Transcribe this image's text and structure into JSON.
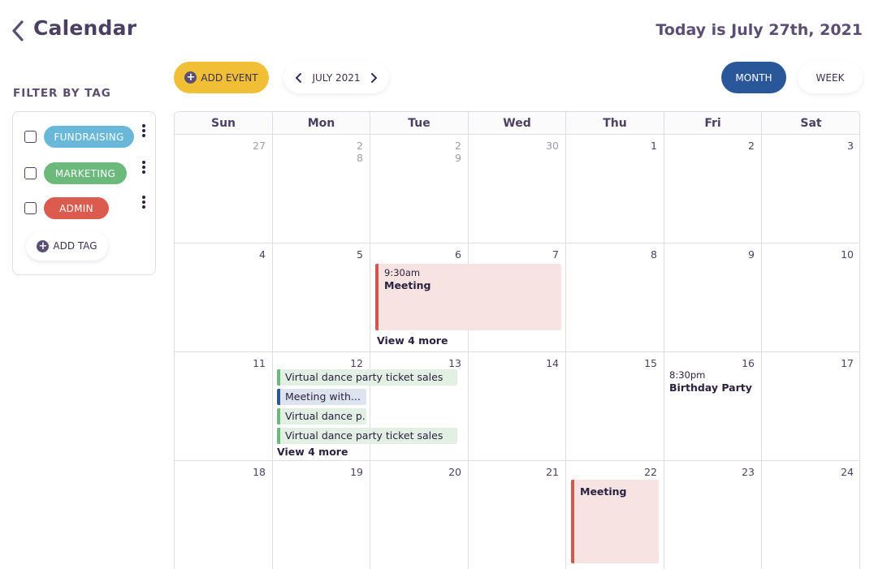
{
  "header": {
    "title": "Calendar",
    "today": "Today is July 27th, 2021"
  },
  "filter": {
    "title": "FILTER BY TAG",
    "tags": [
      {
        "label": "FUNDRAISING",
        "color": "#6ab8d9"
      },
      {
        "label": "MARKETING",
        "color": "#6cb97c"
      },
      {
        "label": "ADMIN",
        "color": "#db5b4f"
      }
    ],
    "add_tag_label": "ADD TAG"
  },
  "toolbar": {
    "add_event_label": "ADD EVENT",
    "month_label": "JULY 2021",
    "view_month": "MONTH",
    "view_week": "WEEK"
  },
  "calendar": {
    "weekdays": [
      "Sun",
      "Mon",
      "Tue",
      "Wed",
      "Thu",
      "Fri",
      "Sat"
    ],
    "weeks": [
      [
        "27",
        "28",
        "29",
        "30",
        "1",
        "2",
        "3"
      ],
      [
        "4",
        "5",
        "6",
        "7",
        "8",
        "9",
        "10"
      ],
      [
        "11",
        "12",
        "13",
        "14",
        "15",
        "16",
        "17"
      ],
      [
        "18",
        "19",
        "20",
        "21",
        "22",
        "23",
        "24"
      ]
    ],
    "events": {
      "meeting_jul6": {
        "time": "9:30am",
        "name": "Meeting"
      },
      "view_more_jul6": "View 4 more",
      "jul12_bars": [
        "Virtual dance party ticket sales",
        "Meeting with...",
        "Virtual dance p..",
        "Virtual dance party ticket sales"
      ],
      "view_more_jul12": "View 4 more",
      "birthday_jul16": {
        "time": "8:30pm",
        "name": "Birthday Party"
      },
      "meeting_jul22": {
        "name": "Meeting"
      }
    }
  }
}
